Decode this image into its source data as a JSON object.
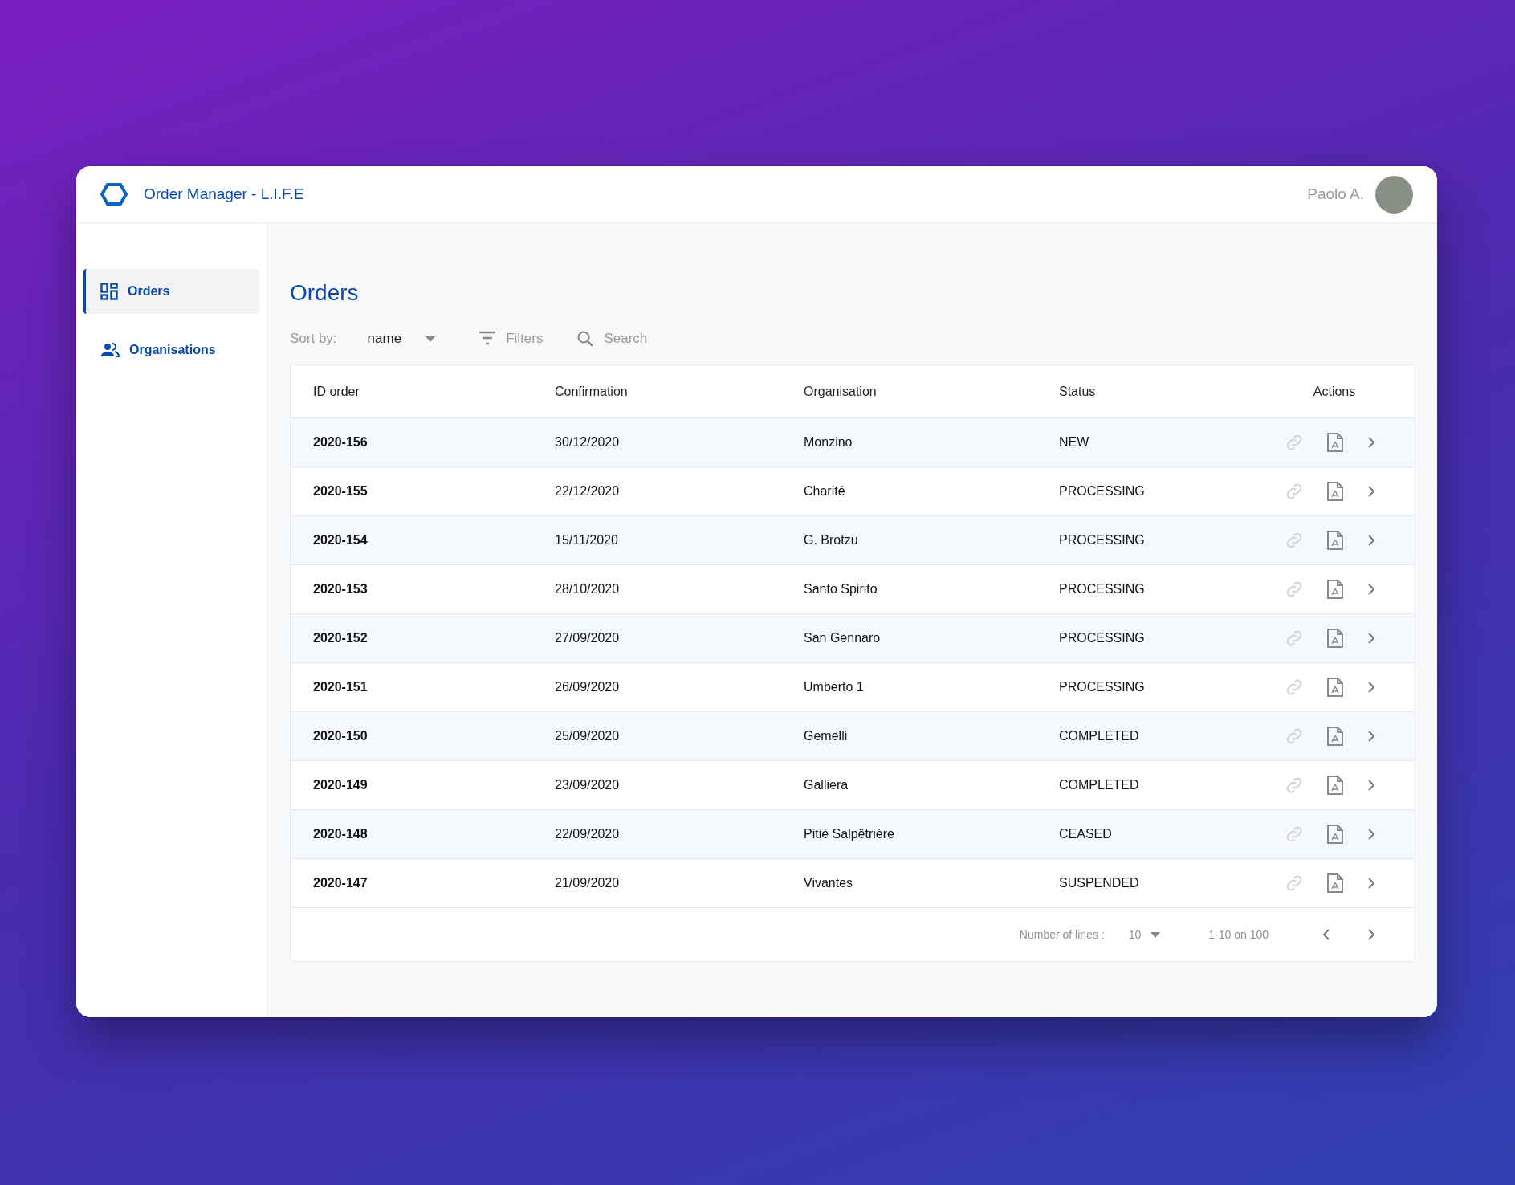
{
  "app": {
    "title": "Order Manager - L.I.F.E",
    "user": "Paolo A."
  },
  "sidebar": {
    "items": [
      {
        "label": "Orders",
        "selected": true
      },
      {
        "label": "Organisations",
        "selected": false
      }
    ]
  },
  "page": {
    "title": "Orders"
  },
  "toolbar": {
    "sort_label": "Sort by:",
    "sort_value": "name",
    "filters": "Filters",
    "search_placeholder": "Search"
  },
  "table": {
    "columns": [
      "ID order",
      "Confirmation",
      "Organisation",
      "Status",
      "Actions"
    ],
    "rows": [
      {
        "id": "2020-156",
        "confirmation": "30/12/2020",
        "organisation": "Monzino",
        "status": "NEW"
      },
      {
        "id": "2020-155",
        "confirmation": "22/12/2020",
        "organisation": "Charité",
        "status": "PROCESSING"
      },
      {
        "id": "2020-154",
        "confirmation": "15/11/2020",
        "organisation": "G. Brotzu",
        "status": "PROCESSING"
      },
      {
        "id": "2020-153",
        "confirmation": "28/10/2020",
        "organisation": "Santo Spirito",
        "status": "PROCESSING"
      },
      {
        "id": "2020-152",
        "confirmation": "27/09/2020",
        "organisation": "San Gennaro",
        "status": "PROCESSING"
      },
      {
        "id": "2020-151",
        "confirmation": "26/09/2020",
        "organisation": "Umberto 1",
        "status": "PROCESSING"
      },
      {
        "id": "2020-150",
        "confirmation": "25/09/2020",
        "organisation": "Gemelli",
        "status": "COMPLETED"
      },
      {
        "id": "2020-149",
        "confirmation": "23/09/2020",
        "organisation": "Galliera",
        "status": "COMPLETED"
      },
      {
        "id": "2020-148",
        "confirmation": "22/09/2020",
        "organisation": "Pitié Salpêtrière",
        "status": "CEASED"
      },
      {
        "id": "2020-147",
        "confirmation": "21/09/2020",
        "organisation": "Vivantes",
        "status": "SUSPENDED"
      }
    ]
  },
  "pagination": {
    "lines_label": "Number of lines :",
    "lines_value": "10",
    "range": "1-10 on 100"
  }
}
